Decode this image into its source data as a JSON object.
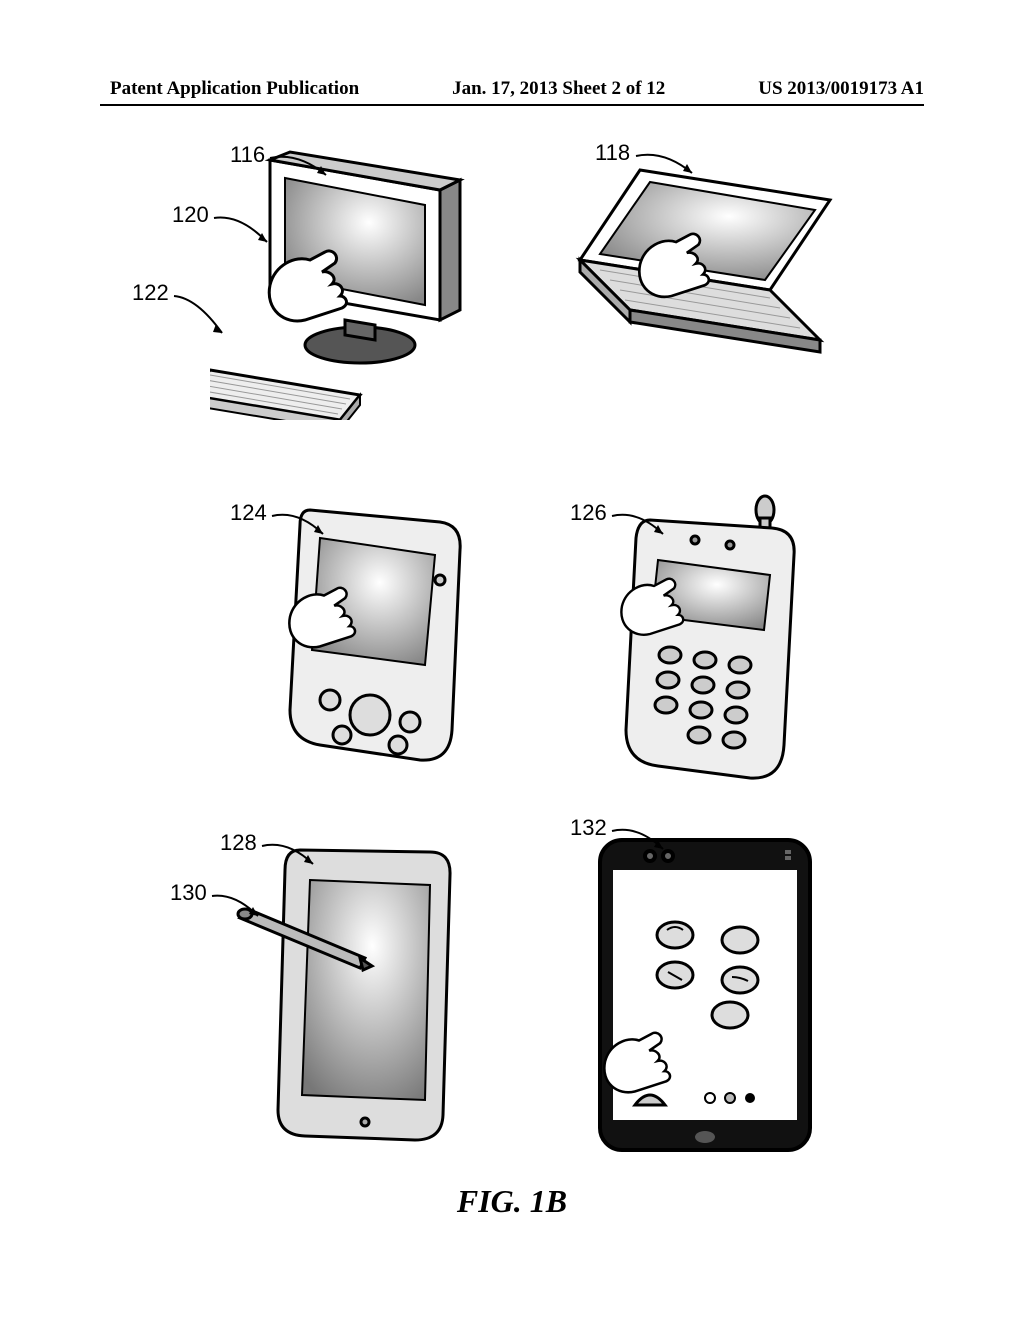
{
  "header": {
    "left": "Patent Application Publication",
    "center": "Jan. 17, 2013  Sheet 2 of 12",
    "right": "US 2013/0019173 A1"
  },
  "refs": {
    "r116": "116",
    "r118": "118",
    "r120": "120",
    "r122": "122",
    "r124": "124",
    "r126": "126",
    "r128": "128",
    "r130": "130",
    "r132": "132"
  },
  "figure_caption": "FIG. 1B"
}
